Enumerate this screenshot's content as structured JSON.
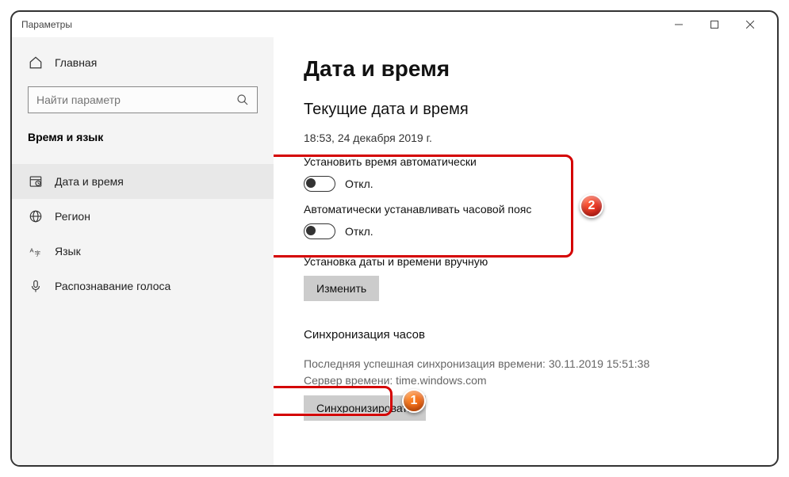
{
  "window": {
    "title": "Параметры"
  },
  "sidebar": {
    "home": "Главная",
    "search_placeholder": "Найти параметр",
    "section": "Время и язык",
    "items": [
      {
        "label": "Дата и время"
      },
      {
        "label": "Регион"
      },
      {
        "label": "Язык"
      },
      {
        "label": "Распознавание голоса"
      }
    ]
  },
  "main": {
    "title": "Дата и время",
    "subtitle": "Текущие дата и время",
    "current_datetime": "18:53, 24 декабря 2019 г.",
    "auto_time_label": "Установить время автоматически",
    "auto_time_state": "Откл.",
    "auto_tz_label": "Автоматически устанавливать часовой пояс",
    "auto_tz_state": "Откл.",
    "manual_label": "Установка даты и времени вручную",
    "change_button": "Изменить",
    "sync_heading": "Синхронизация часов",
    "last_sync": "Последняя успешная синхронизация времени: 30.11.2019 15:51:38",
    "time_server": "Сервер времени: time.windows.com",
    "sync_button": "Синхронизировать"
  },
  "annotations": {
    "callout1": "1",
    "callout2": "2"
  }
}
